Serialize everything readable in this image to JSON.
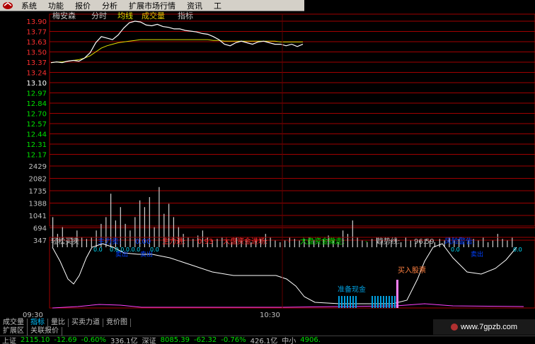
{
  "menu": {
    "items": [
      "系统",
      "功能",
      "报价",
      "分析",
      "扩展市场行情",
      "资讯",
      "工"
    ]
  },
  "chart_header": {
    "stock_name": "梅安森",
    "mode": "分时",
    "avg_label": "均线",
    "volume_label": "成交量",
    "index_label": "指标"
  },
  "price_axis": [
    "13.90",
    "13.77",
    "13.63",
    "13.50",
    "13.37",
    "13.24",
    "13.10",
    "12.97",
    "12.84",
    "12.70",
    "12.57",
    "12.44",
    "12.31",
    "12.17"
  ],
  "volume_axis": [
    "2429",
    "2082",
    "1735",
    "1388",
    "1041",
    "694",
    "347"
  ],
  "indicator": {
    "name": "轻松买卖",
    "main_sell_label": "主力卖:",
    "main_sell_value": "0.00",
    "main_in_label": "主力进:",
    "main_in_value": "0.93",
    "big_in_label": "大盘资金进场:",
    "big_in_value": "-",
    "big_out_label": "大盘资金撤走:",
    "big_out_value": "-",
    "trend_label": "趋势线:",
    "trend_value": "96.59",
    "risk_label": "风险警告:",
    "risk_value": "",
    "prepare_cash": "准备现金",
    "buy_stock": "买入股票",
    "sell_label": "卖出",
    "peak_marks": [
      "0.0",
      "0.0.0.0.0.0",
      "0.0",
      "0.0",
      "0.0"
    ]
  },
  "time_axis": [
    "09:30",
    "10:30"
  ],
  "tabs": [
    "成交量",
    "指标",
    "量比",
    "买卖力道",
    "竞价图"
  ],
  "active_tab": "指标",
  "tabs2": [
    "扩展区",
    "关联报价"
  ],
  "status": {
    "sh_label": "上证",
    "sh_value": "2115.10",
    "sh_change": "-12.69",
    "sh_pct": "-0.60%",
    "sh_amount": "336.1亿",
    "sz_label": "深证",
    "sz_value": "8085.39",
    "sz_change": "-62.32",
    "sz_pct": "-0.76%",
    "sz_amount": "426.1亿",
    "zx_label": "中小",
    "zx_value": "4906."
  },
  "watermark": "www.7gpzb.com",
  "colors": {
    "grid_red": "#a00000",
    "price_line": "#ffffff",
    "avg_line": "#e0e000",
    "up_text": "#ff3030",
    "down_text": "#00e000",
    "bar_cyan": "#00a0e0",
    "magenta": "#ff40ff"
  }
}
